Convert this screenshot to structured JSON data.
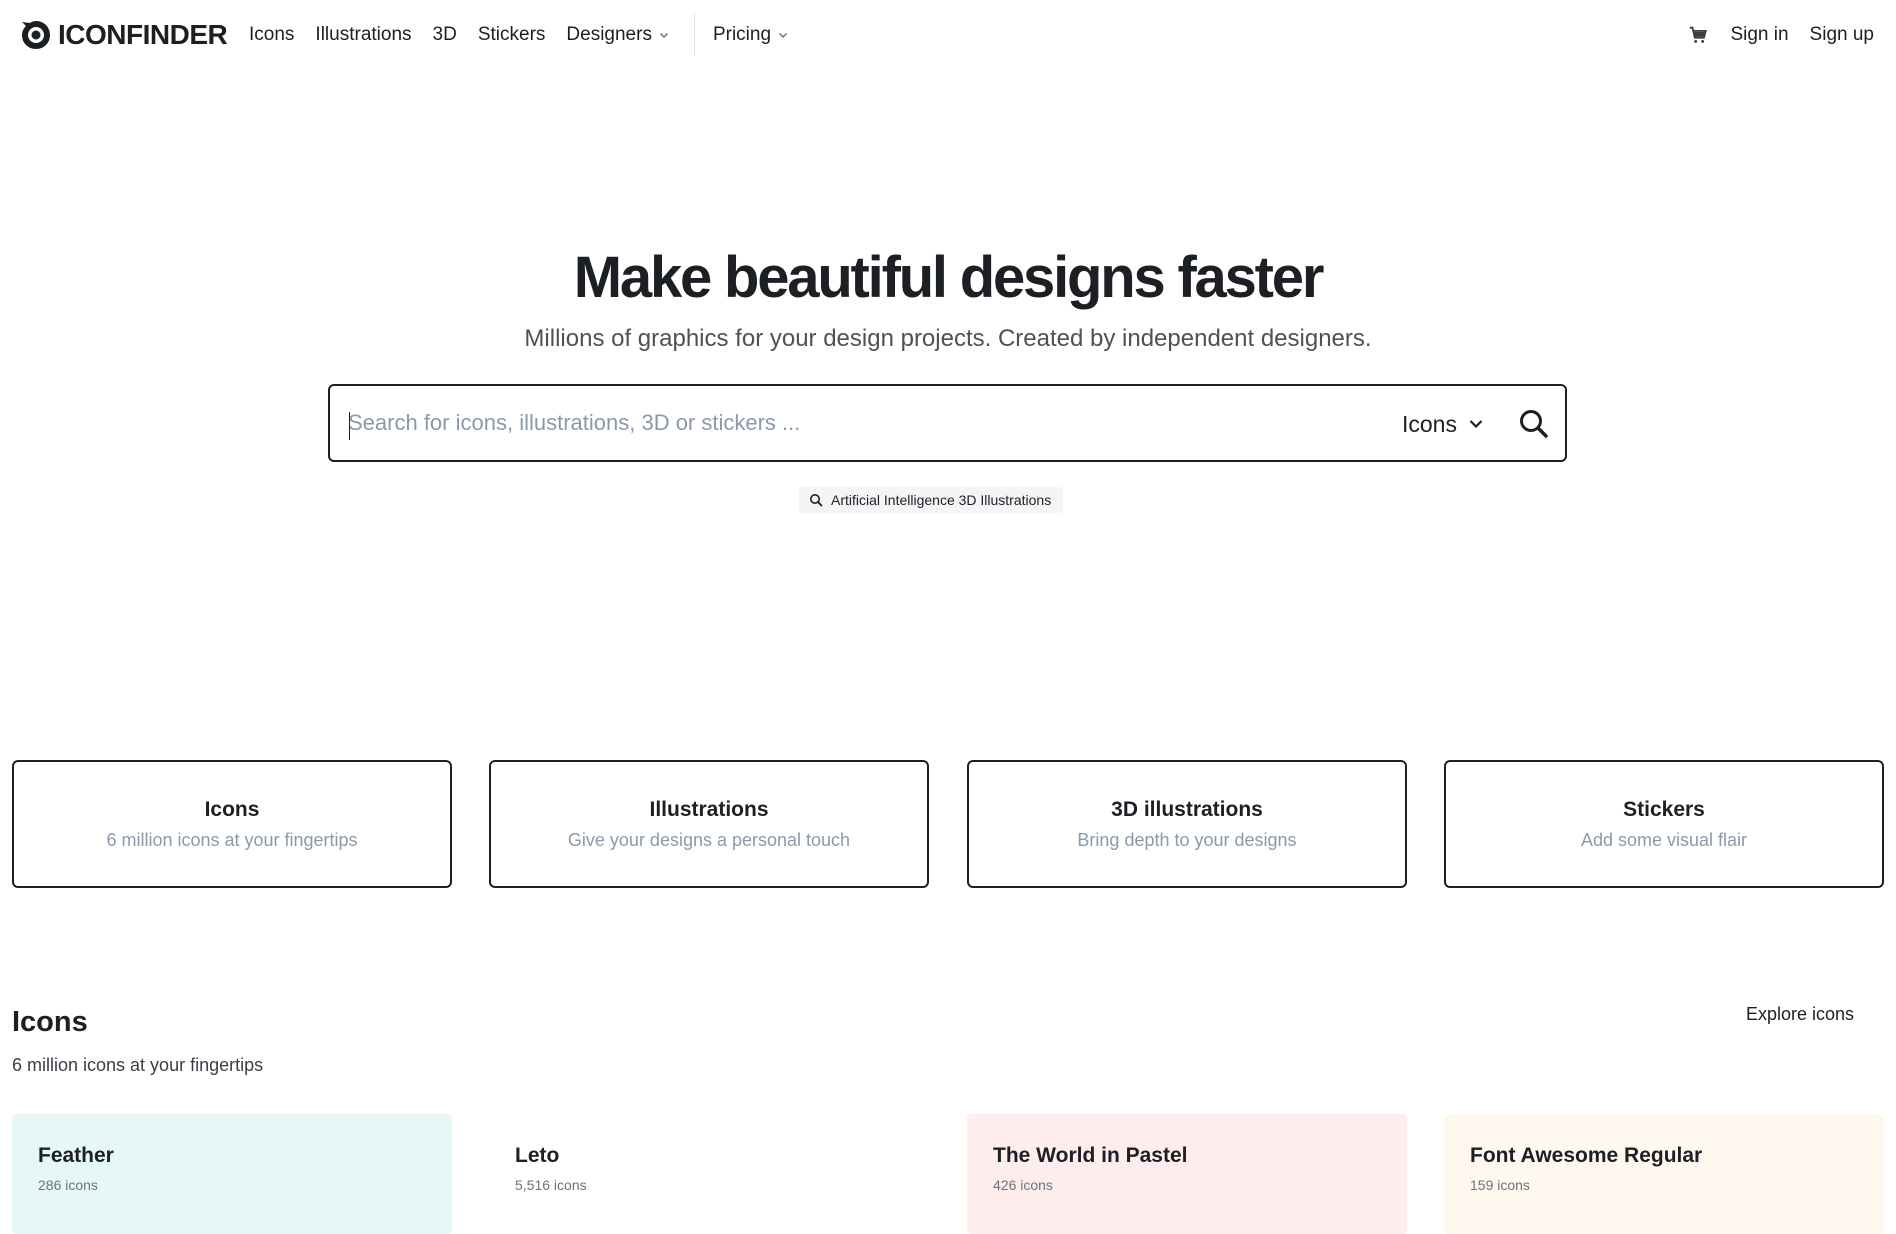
{
  "brand": {
    "name": "ICONFINDER"
  },
  "nav": {
    "links": [
      {
        "label": "Icons"
      },
      {
        "label": "Illustrations"
      },
      {
        "label": "3D"
      },
      {
        "label": "Stickers"
      },
      {
        "label": "Designers",
        "dropdown": true
      }
    ],
    "pricing": "Pricing",
    "sign_in": "Sign in",
    "sign_up": "Sign up"
  },
  "hero": {
    "title_pre": "Make ",
    "title_highlight": "beautiful designs",
    "title_post": " faster",
    "highlight_color": "#fde7b8",
    "subtitle": "Millions of graphics for your design projects. Created by independent designers."
  },
  "search": {
    "placeholder": "Search for icons, illustrations, 3D or stickers ...",
    "value": "",
    "type_selected": "Icons",
    "suggestion": "Artificial Intelligence 3D Illustrations"
  },
  "categories": [
    {
      "title": "Icons",
      "subtitle": "6 million icons at your fingertips"
    },
    {
      "title": "Illustrations",
      "subtitle": "Give your designs a personal touch"
    },
    {
      "title": "3D illustrations",
      "subtitle": "Bring depth to your designs"
    },
    {
      "title": "Stickers",
      "subtitle": "Add some visual flair"
    }
  ],
  "icons_section": {
    "title": "Icons",
    "subtitle": "6 million icons at your fingertips",
    "explore": "Explore icons",
    "sets": [
      {
        "title": "Feather",
        "count": "286 icons",
        "bg": "#e6f8f6"
      },
      {
        "title": "Leto",
        "count": "5,516 icons",
        "bg": "#ffffff"
      },
      {
        "title": "The World in Pastel",
        "count": "426 icons",
        "bg": "#fdeeed"
      },
      {
        "title": "Font Awesome Regular",
        "count": "159 icons",
        "bg": "#fef8ee"
      }
    ]
  }
}
